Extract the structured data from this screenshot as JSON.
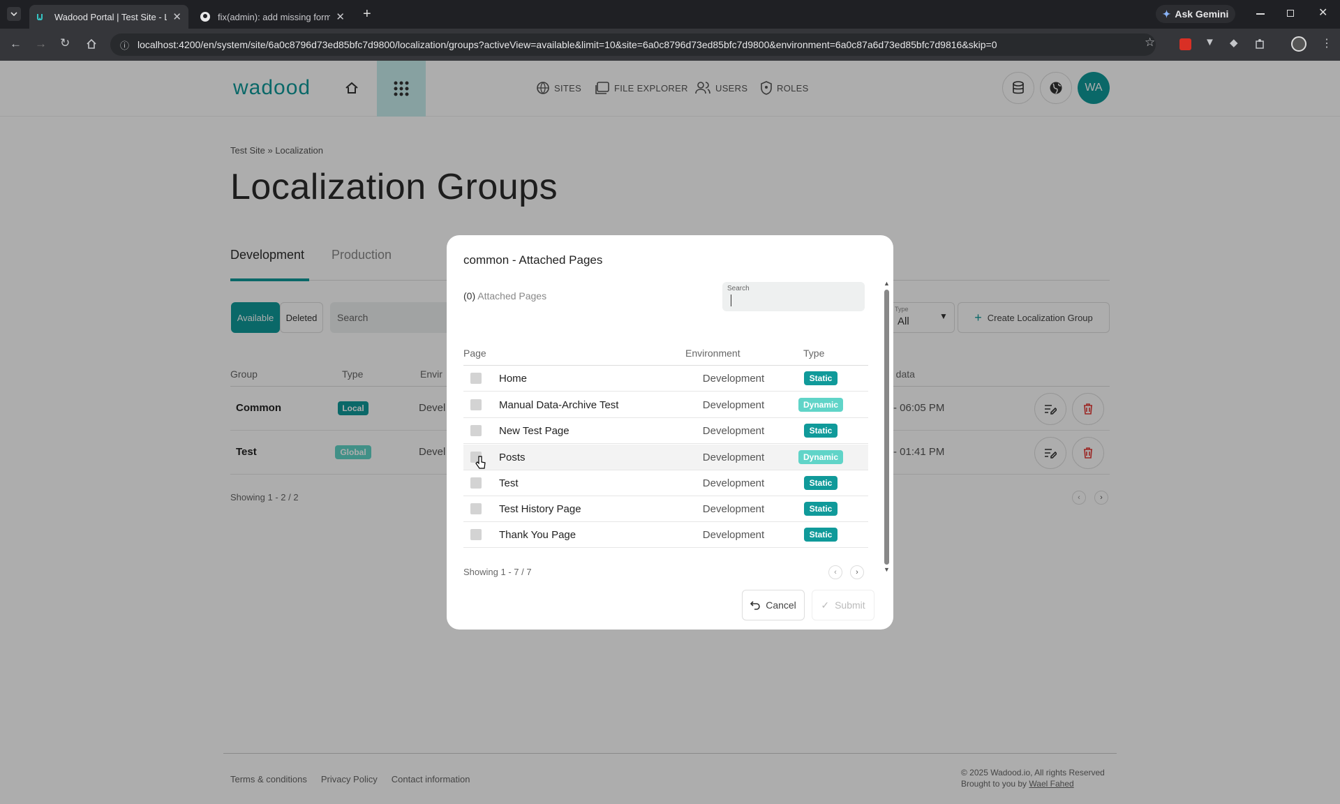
{
  "browser": {
    "tabs": [
      {
        "title": "Wadood Portal | Test Site - Loca",
        "active": true
      },
      {
        "title": "fix(admin): add missing form.va",
        "active": false
      }
    ],
    "url": "localhost:4200/en/system/site/6a0c8796d73ed85bfc7d9800/localization/groups?activeView=available&limit=10&site=6a0c8796d73ed85bfc7d9800&environment=6a0c87a6d73ed85bfc7d9816&skip=0",
    "gemini_label": "Ask Gemini"
  },
  "header": {
    "logo": "wadood",
    "nav": [
      {
        "label": "SITES",
        "icon": "globe-icon"
      },
      {
        "label": "FILE EXPLORER",
        "icon": "images-icon"
      },
      {
        "label": "USERS",
        "icon": "users-icon"
      },
      {
        "label": "ROLES",
        "icon": "shield-icon"
      }
    ],
    "avatar": "WA"
  },
  "page": {
    "breadcrumb": {
      "site": "Test Site",
      "current": "» Localization"
    },
    "title": "Localization Groups",
    "env_tabs": [
      "Development",
      "Production"
    ],
    "filters": {
      "available": "Available",
      "deleted": "Deleted",
      "search_placeholder": "Search",
      "type_label": "Type",
      "type_value": "All"
    },
    "create_button": "Create Localization Group",
    "columns": {
      "group": "Group",
      "type": "Type",
      "env": "Envir",
      "data": "n data"
    },
    "rows": [
      {
        "group": "Common",
        "type": "Local",
        "env": "Devel",
        "date": "- 06:05 PM"
      },
      {
        "group": "Test",
        "type": "Global",
        "env": "Devel",
        "date": "- 01:41 PM"
      }
    ],
    "showing": "Showing 1 - 2 / 2"
  },
  "modal": {
    "title": "common - Attached Pages",
    "count": "(0)",
    "count_label": "Attached Pages",
    "search_label": "Search",
    "columns": {
      "page": "Page",
      "environment": "Environment",
      "type": "Type"
    },
    "rows": [
      {
        "page": "Home",
        "environment": "Development",
        "type": "Static"
      },
      {
        "page": "Manual Data-Archive Test",
        "environment": "Development",
        "type": "Dynamic"
      },
      {
        "page": "New Test Page",
        "environment": "Development",
        "type": "Static"
      },
      {
        "page": "Posts",
        "environment": "Development",
        "type": "Dynamic"
      },
      {
        "page": "Test",
        "environment": "Development",
        "type": "Static"
      },
      {
        "page": "Test History Page",
        "environment": "Development",
        "type": "Static"
      },
      {
        "page": "Thank You Page",
        "environment": "Development",
        "type": "Static"
      }
    ],
    "showing": "Showing 1 - 7 / 7",
    "cancel": "Cancel",
    "submit": "Submit"
  },
  "footer": {
    "links": [
      "Terms & conditions",
      "Privacy Policy",
      "Contact information"
    ],
    "copyright": "© 2025 Wadood.io, All rights Reserved",
    "brought": "Brought to you by",
    "author": "Wael Fahed"
  },
  "colors": {
    "accent": "#109a9a",
    "dynamic": "#60d4c8",
    "danger": "#e53935"
  }
}
